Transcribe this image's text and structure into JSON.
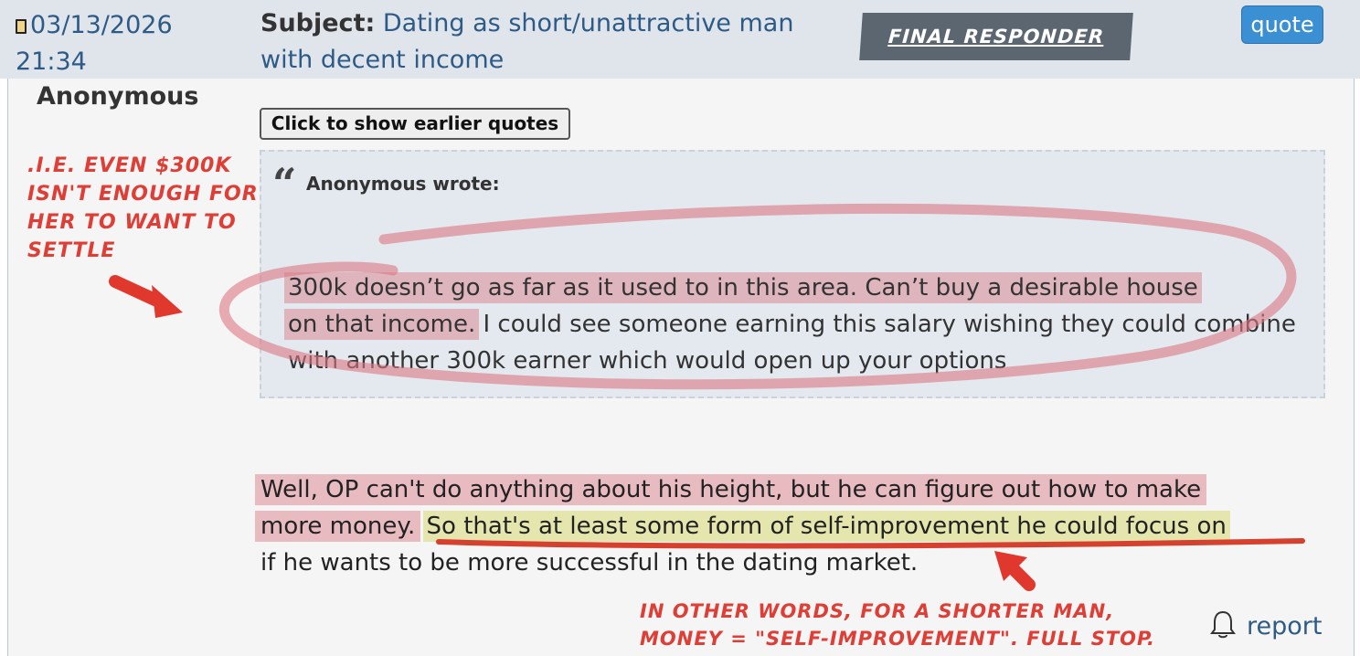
{
  "post": {
    "date": "03/13/2026",
    "time": "21:34",
    "subject_label": "Subject:",
    "subject_text": "Dating as short/unattractive man with decent income",
    "badge": "FINAL RESPONDER",
    "quote_button": "quote",
    "author": "Anonymous",
    "earlier_quotes_button": "Click to show earlier quotes",
    "quote": {
      "attribution": "Anonymous wrote:",
      "highlighted_1": "300k doesn’t go as far as it used to in this area. Can’t buy a desirable house",
      "highlighted_2": "on that income.",
      "rest": " I could see someone earning this salary wishing they could combine with another 300k earner which would open up your options"
    },
    "body": {
      "highlight_red_1": "Well, OP can't do anything about his height, but he can figure out how to make",
      "highlight_red_2": "more money.",
      "highlight_yellow": "So that's at least some form of self-improvement he could focus on",
      "rest": "if he wants to be more successful in the dating market."
    },
    "report_label": "report"
  },
  "annotations": {
    "left_note": ".I.E. EVEN $300K ISN'T ENOUGH FOR HER TO WANT TO SETTLE",
    "bottom_note_1": "IN OTHER WORDS, FOR A SHORTER MAN,",
    "bottom_note_2": "MONEY = \"SELF-IMPROVEMENT\". FULL STOP."
  },
  "colors": {
    "header_bg": "#dfe5eb",
    "link": "#2d5a86",
    "quote_button": "#3b8fd3",
    "badge_bg": "#5c6670",
    "annotation_red": "#de3e35",
    "highlight_red": "#dc828c",
    "highlight_yellow": "#e4e6ad"
  }
}
